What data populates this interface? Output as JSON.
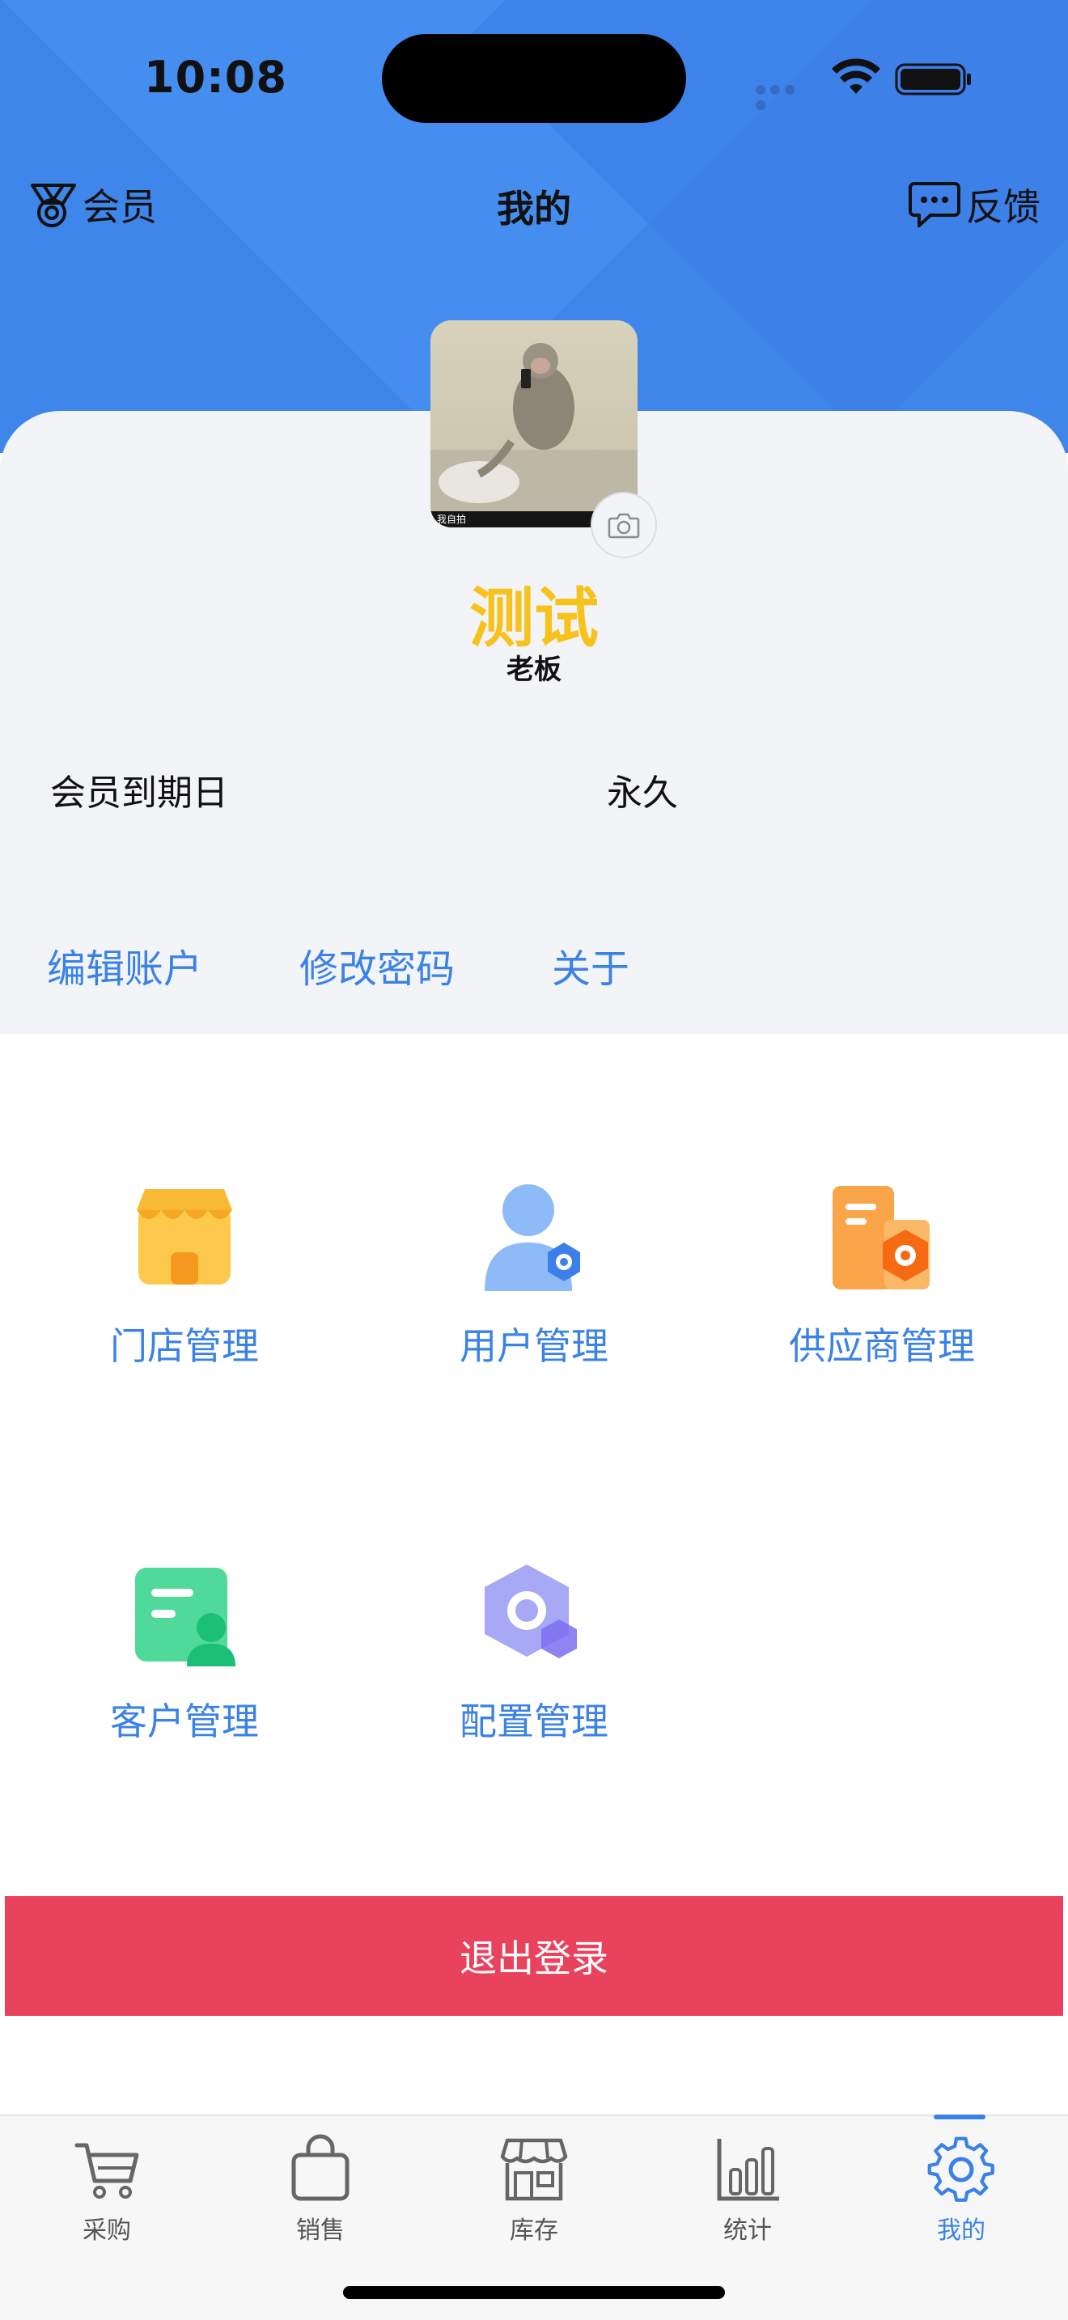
{
  "status_bar": {
    "time": "10:08"
  },
  "header": {
    "member_label": "会员",
    "title": "我的",
    "feedback_label": "反馈"
  },
  "profile": {
    "name": "测试",
    "role": "老板",
    "avatar_caption": "我自拍",
    "expiry_label": "会员到期日",
    "expiry_value": "永久"
  },
  "account_links": [
    "编辑账户",
    "修改密码",
    "关于"
  ],
  "modules": [
    {
      "label": "门店管理",
      "icon": "store-icon"
    },
    {
      "label": "用户管理",
      "icon": "user-settings-icon"
    },
    {
      "label": "供应商管理",
      "icon": "supplier-icon"
    },
    {
      "label": "客户管理",
      "icon": "customer-icon"
    },
    {
      "label": "配置管理",
      "icon": "config-icon"
    }
  ],
  "logout_label": "退出登录",
  "tabbar": {
    "items": [
      {
        "label": "采购",
        "icon": "cart-icon"
      },
      {
        "label": "销售",
        "icon": "bag-icon"
      },
      {
        "label": "库存",
        "icon": "warehouse-icon"
      },
      {
        "label": "统计",
        "icon": "chart-icon"
      },
      {
        "label": "我的",
        "icon": "gear-icon"
      }
    ],
    "active_index": 4
  },
  "colors": {
    "primary": "#3b82e6",
    "header_bg": "#3f86ea",
    "name_color": "#f7c21c",
    "logout_bg": "#e9425c"
  }
}
